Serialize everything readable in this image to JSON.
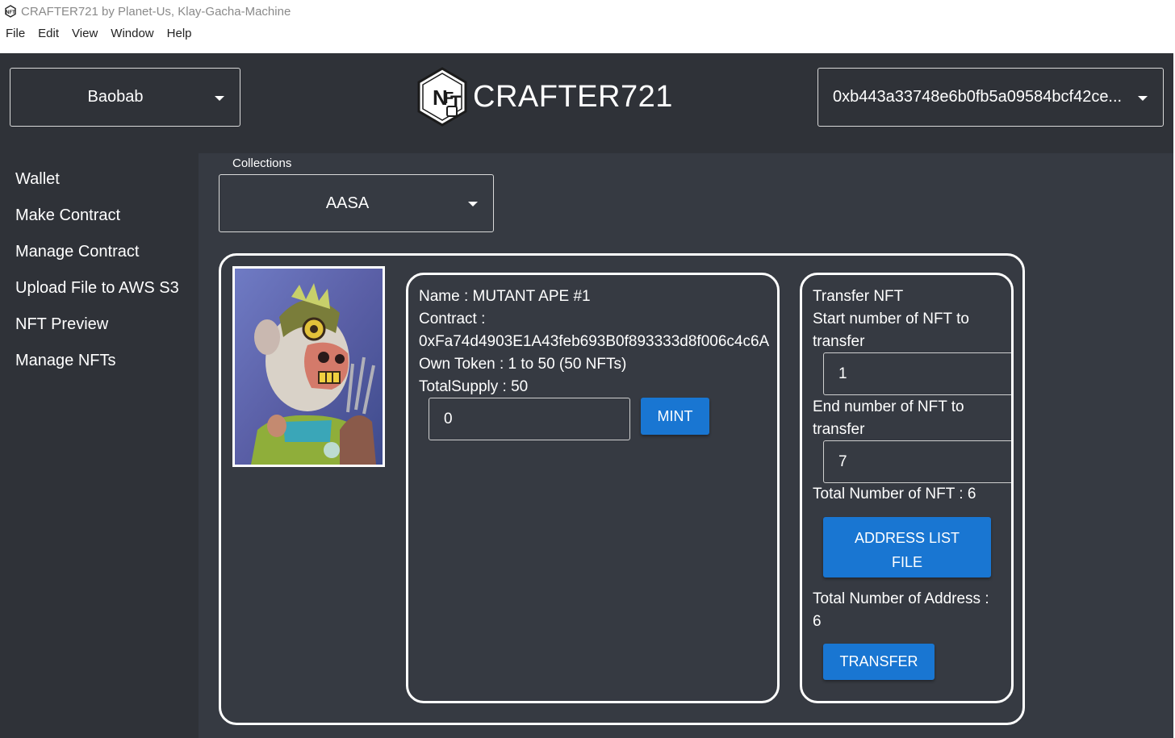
{
  "window": {
    "title": "CRAFTER721 by Planet-Us, Klay-Gacha-Machine"
  },
  "menu": [
    "File",
    "Edit",
    "View",
    "Window",
    "Help"
  ],
  "header": {
    "network": "Baobab",
    "brand": "CRAFTER721",
    "account": "0xb443a33748e6b0fb5a09584bcf42ce..."
  },
  "sidebar": {
    "items": [
      "Wallet",
      "Make Contract",
      "Manage Contract",
      "Upload File to AWS S3",
      "NFT Preview",
      "Manage NFTs"
    ]
  },
  "main": {
    "collections_label": "Collections",
    "collection": "AASA",
    "info": {
      "name": "Name : MUTANT APE #1",
      "contract_label": "Contract :",
      "contract_address": "0xFa74d4903E1A43feb693B0f893333d8f006c4c6A",
      "own_token": "Own Token : 1 to 50 (50 NFTs)",
      "total_supply": "TotalSupply : 50",
      "mint_value": "0",
      "mint_button": "MINT"
    },
    "transfer": {
      "title": "Transfer NFT",
      "start_label_1": "Start number of NFT to",
      "start_label_2": "transfer",
      "start_value": "1",
      "end_label_1": "End number of NFT to",
      "end_label_2": "transfer",
      "end_value": "7",
      "total_nft": "Total Number of NFT : 6",
      "address_button_1": "ADDRESS LIST",
      "address_button_2": "FILE",
      "total_address_1": "Total Number of Address :",
      "total_address_2": "6",
      "transfer_button": "TRANSFER"
    }
  },
  "colors": {
    "app_background": "#2f3238",
    "main_background": "#363a42",
    "button_primary": "#1976d2"
  }
}
